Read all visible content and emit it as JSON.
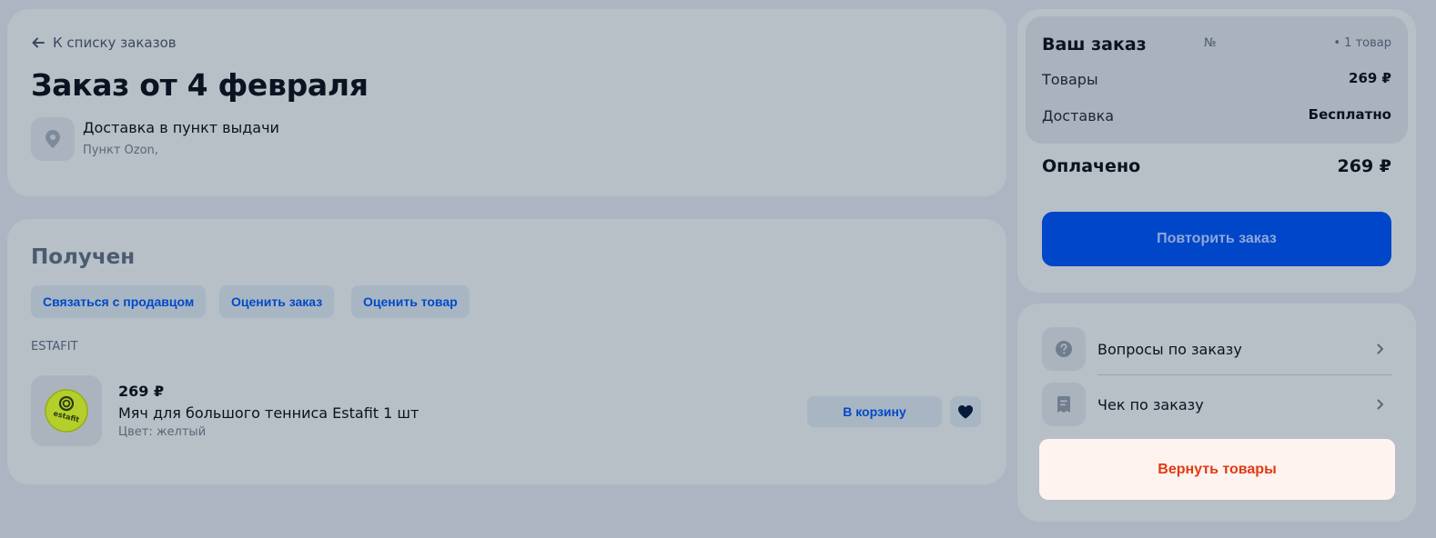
{
  "header": {
    "back_label": "К списку заказов",
    "title": "Заказ от 4 февраля",
    "delivery_title": "Доставка в пункт выдачи",
    "delivery_sub": "Пункт Ozon,"
  },
  "order": {
    "status": "Получен",
    "actions": [
      "Связаться с продавцом",
      "Оценить заказ",
      "Оценить товар"
    ],
    "seller": "ESTAFIT",
    "item": {
      "price": "269 ₽",
      "name": "Мяч для большого тенниса Estafit 1 шт",
      "color": "Цвет: желтый",
      "cart_label": "В корзину",
      "ball_text": "estafit"
    }
  },
  "summary": {
    "title": "Ваш заказ",
    "number_label": "№",
    "count": "• 1 товар",
    "goods_label": "Товары",
    "goods_value": "269 ₽",
    "delivery_label": "Доставка",
    "delivery_value": "Бесплатно",
    "paid_label": "Оплачено",
    "paid_value": "269 ₽",
    "repeat_label": "Повторить заказ"
  },
  "side_actions": {
    "questions_label": "Вопросы по заказу",
    "receipt_label": "Чек по заказу",
    "return_label": "Вернуть товары"
  },
  "colors": {
    "background": "#adb5c2",
    "card": "#b7bfc7",
    "accent_blue": "#0046c8",
    "return_red": "#e23a12",
    "return_bg": "#fff3ef"
  }
}
